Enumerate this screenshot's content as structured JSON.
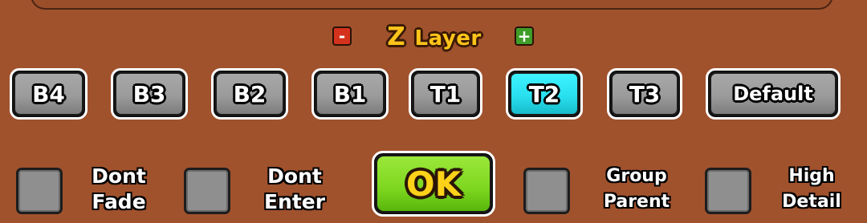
{
  "header": {
    "minus_label": "-",
    "plus_label": "+",
    "title_z": "Z",
    "title_layer": "Layer"
  },
  "layers": {
    "b4": "B4",
    "b3": "B3",
    "b2": "B2",
    "b1": "B1",
    "t1": "T1",
    "t2": "T2",
    "t3": "T3",
    "default": "Default",
    "selected": "T2"
  },
  "options": {
    "dont_fade": [
      "Dont",
      "Fade"
    ],
    "dont_enter": [
      "Dont",
      "Enter"
    ],
    "group_parent": [
      "Group",
      "Parent"
    ],
    "high_detail": [
      "High",
      "Detail"
    ]
  },
  "ok_label": "OK",
  "colors": {
    "background": "#a0522d",
    "button_gray": "#9b9b9b",
    "button_active": "#29e0ef",
    "ok_green": "#7dd61e",
    "title_yellow": "#ffc41a"
  }
}
